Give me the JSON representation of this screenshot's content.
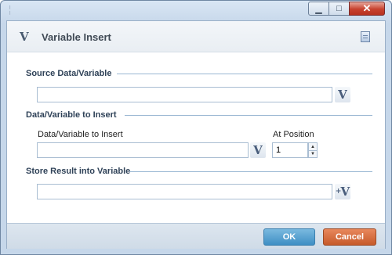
{
  "window": {
    "title": "",
    "minimize_glyph": "▁",
    "maximize_glyph": "□",
    "close_glyph": "✕"
  },
  "dialog": {
    "icon_glyph": "V",
    "title": "Variable Insert"
  },
  "source": {
    "section_label": "Source Data/Variable",
    "value": "",
    "variable_button_glyph": "V"
  },
  "insert": {
    "section_label": "Data/Variable to Insert",
    "field_label": "Data/Variable to Insert",
    "value": "",
    "variable_button_glyph": "V",
    "position_label": "At Position",
    "position_value": "1",
    "spin_up_glyph": "▲",
    "spin_down_glyph": "▼"
  },
  "result": {
    "section_label": "Store Result into Variable",
    "value": "",
    "variable_button_glyph": "V",
    "variable_button_arrow": "+"
  },
  "footer": {
    "ok_label": "OK",
    "cancel_label": "Cancel"
  },
  "colors": {
    "ok_button": "#3e8fc4",
    "cancel_button": "#c65a2a",
    "section_line": "#9ab7d3"
  }
}
